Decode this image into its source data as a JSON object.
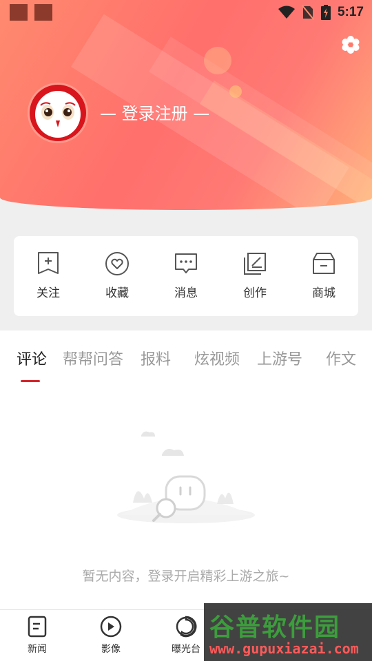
{
  "status_bar": {
    "time": "5:17"
  },
  "header": {
    "login_text": "— 登录注册 —"
  },
  "quick_actions": [
    {
      "label": "关注",
      "icon": "bookmark-plus-icon"
    },
    {
      "label": "收藏",
      "icon": "heart-circle-icon"
    },
    {
      "label": "消息",
      "icon": "message-bubble-icon"
    },
    {
      "label": "创作",
      "icon": "edit-document-icon"
    },
    {
      "label": "商城",
      "icon": "store-box-icon"
    }
  ],
  "tabs": [
    {
      "label": "评论",
      "active": true
    },
    {
      "label": "帮帮问答"
    },
    {
      "label": "报料"
    },
    {
      "label": "炫视频"
    },
    {
      "label": "上游号"
    },
    {
      "label": "作文"
    }
  ],
  "empty_state": {
    "text": "暂无内容，登录开启精彩上游之旅~"
  },
  "bottom_nav": [
    {
      "label": "新闻",
      "icon": "news-icon"
    },
    {
      "label": "影像",
      "icon": "image-icon"
    },
    {
      "label": "曝光台",
      "icon": "spotlight-icon"
    }
  ],
  "watermark": {
    "title": "谷普软件园",
    "url": "www.gupuxiazai.com"
  },
  "colors": {
    "accent": "#d6242b",
    "header_gradient_start": "#ff8a6e",
    "header_gradient_end": "#ffb07a"
  }
}
